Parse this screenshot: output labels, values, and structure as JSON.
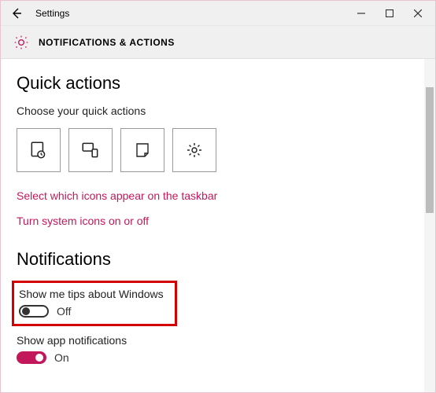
{
  "titlebar": {
    "app_title": "Settings"
  },
  "header": {
    "page_title": "NOTIFICATIONS & ACTIONS"
  },
  "quick_actions": {
    "heading": "Quick actions",
    "subheading": "Choose your quick actions",
    "tiles": [
      {
        "icon": "tablet-mode-icon"
      },
      {
        "icon": "connect-icon"
      },
      {
        "icon": "note-icon"
      },
      {
        "icon": "settings-icon"
      }
    ],
    "link_taskbar": "Select which icons appear on the taskbar",
    "link_system": "Turn system icons on or off"
  },
  "notifications": {
    "heading": "Notifications",
    "tips": {
      "label": "Show me tips about Windows",
      "state_text": "Off",
      "on": false
    },
    "app": {
      "label": "Show app notifications",
      "state_text": "On",
      "on": true
    }
  }
}
